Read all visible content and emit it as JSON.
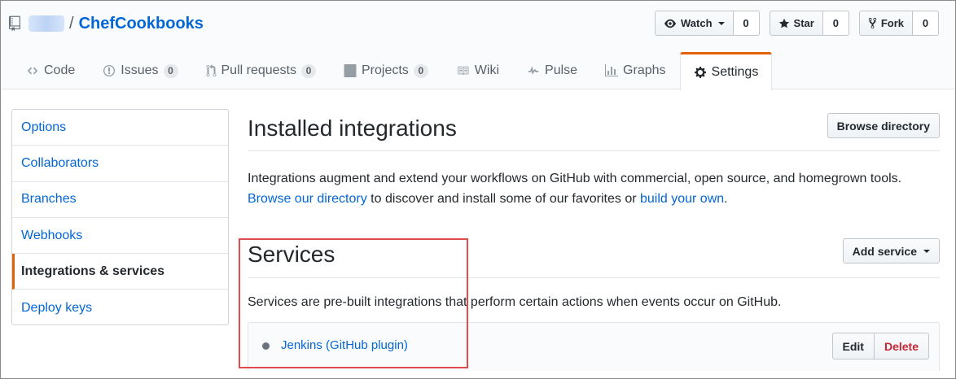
{
  "repo": {
    "separator": "/",
    "name": "ChefCookbooks"
  },
  "actions": {
    "watch": {
      "label": "Watch",
      "count": "0"
    },
    "star": {
      "label": "Star",
      "count": "0"
    },
    "fork": {
      "label": "Fork",
      "count": "0"
    }
  },
  "tabs": [
    {
      "label": "Code",
      "icon": "code-icon"
    },
    {
      "label": "Issues",
      "count": "0",
      "icon": "issue-icon"
    },
    {
      "label": "Pull requests",
      "count": "0",
      "icon": "pull-request-icon"
    },
    {
      "label": "Projects",
      "count": "0",
      "icon": "project-icon"
    },
    {
      "label": "Wiki",
      "icon": "book-icon"
    },
    {
      "label": "Pulse",
      "icon": "pulse-icon"
    },
    {
      "label": "Graphs",
      "icon": "graph-icon"
    },
    {
      "label": "Settings",
      "icon": "gear-icon",
      "selected": true
    }
  ],
  "sidebar": {
    "items": [
      {
        "label": "Options"
      },
      {
        "label": "Collaborators"
      },
      {
        "label": "Branches"
      },
      {
        "label": "Webhooks"
      },
      {
        "label": "Integrations & services",
        "selected": true
      },
      {
        "label": "Deploy keys"
      }
    ]
  },
  "integrations": {
    "title": "Installed integrations",
    "browse_button": "Browse directory",
    "desc_line1": "Integrations augment and extend your workflows on GitHub with commercial, open source, and homegrown tools.",
    "desc_link1": "Browse our directory",
    "desc_mid": " to discover and install some of our favorites or ",
    "desc_link2": "build your own",
    "desc_end": "."
  },
  "services": {
    "title": "Services",
    "add_button": "Add service",
    "desc": "Services are pre-built integrations that perform certain actions when events occur on GitHub.",
    "items": [
      {
        "name": "Jenkins (GitHub plugin)",
        "edit_label": "Edit",
        "delete_label": "Delete"
      }
    ]
  },
  "colors": {
    "link": "#0366d6",
    "accent_tab": "#e36209",
    "delete": "#cb2431",
    "highlight": "#e04c4c"
  }
}
